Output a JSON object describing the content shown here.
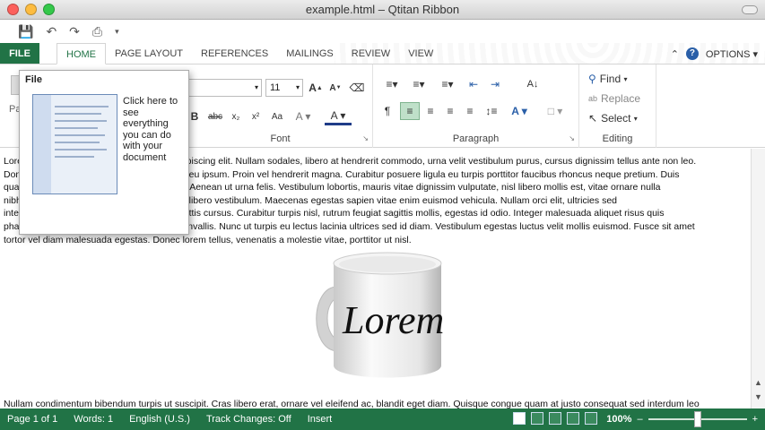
{
  "window": {
    "title": "example.html – Qtitan Ribbon"
  },
  "qat": {
    "save_icon": "save-icon",
    "undo_icon": "undo-icon",
    "redo_icon": "redo-icon",
    "print_icon": "print-icon"
  },
  "tabs": [
    {
      "label": "FILE"
    },
    {
      "label": "HOME"
    },
    {
      "label": "PAGE LAYOUT"
    },
    {
      "label": "REFERENCES"
    },
    {
      "label": "MAILINGS"
    },
    {
      "label": "REVIEW"
    },
    {
      "label": "VIEW"
    }
  ],
  "options_label": "OPTIONS",
  "ribbon": {
    "clipboard_partial": "Pa",
    "font_size": "11",
    "font_group": "Font",
    "paragraph_group": "Paragraph",
    "editing_group": "Editing",
    "find": "Find",
    "replace": "Replace",
    "select": "Select"
  },
  "popup": {
    "title": "File",
    "description": "Click here to see everything you can do with your document"
  },
  "document": {
    "lines": [
      "Lorem ipsum dolor sit amet, consectetur adipiscing elit. Nullam sodales, libero at hendrerit commodo, urna velit vestibulum purus, cursus dignissim tellus ante non leo.",
      "Donec pellentesque, ante tristique varius ac eu ipsum. Proin vel hendrerit magna. Curabitur posuere ligula eu turpis porttitor faucibus rhoncus neque pretium. Duis",
      "quam velit, volutpat ac ornare quat at purus. Aenean ut urna felis. Vestibulum lobortis, mauris vitae dignissim vulputate, nisl libero mollis est, vitae ornare nulla",
      "nibh quis tellus, ipsum est quat quis pretium libero vestibulum. Maecenas egestas sapien vitae enim euismod vehicula. Nullam orci elit, ultricies sed",
      "interdum ut, gravida et tellus. Nullam as sagittis cursus. Curabitur turpis nisl, rutrum feugiat sagittis mollis, egestas id odio. Integer malesuada aliquet risus quis",
      "pharetra. Vivamus luctus fermentum, nec convallis. Nunc ut turpis eu lectus lacinia ultrices sed id diam. Vestibulum egestas luctus velit mollis euismod. Fusce sit amet",
      "tortor vel diam malesuada egestas. Donec lorem tellus, venenatis a molestie vitae, porttitor ut nisl."
    ],
    "mug_text": "Lorem",
    "bottom_line": "Nullam condimentum bibendum turpis ut suscipit. Cras libero erat, ornare vel eleifend ac, blandit eget diam. Quisque congue quam at justo consequat sed interdum leo"
  },
  "status": {
    "page": "Page 1 of 1",
    "words": "Words: 1",
    "language": "English (U.S.)",
    "track": "Track Changes: Off",
    "mode": "Insert",
    "zoom": "100%",
    "zoom_level": 0.5,
    "minus": "–",
    "plus": "+"
  },
  "colors": {
    "accent": "#217346"
  }
}
